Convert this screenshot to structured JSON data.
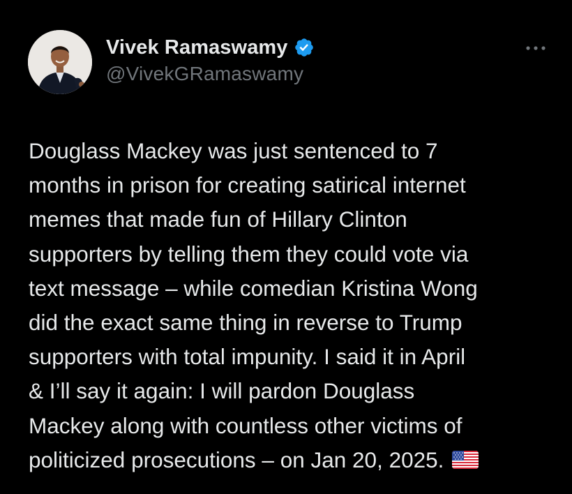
{
  "author": {
    "display_name": "Vivek Ramaswamy",
    "handle": "@VivekGRamaswamy",
    "verified": true,
    "verified_icon": "verified-badge-icon",
    "avatar_icon": "profile-photo"
  },
  "more_button": {
    "label": "•••",
    "icon": "more-options-icon"
  },
  "tweet": {
    "lines": [
      "Douglass Mackey was just sentenced to 7",
      "months in prison for creating satirical internet",
      "memes that made fun of Hillary Clinton",
      "supporters by telling them they could vote via",
      "text message – while comedian Kristina Wong",
      "did the exact same thing in reverse to Trump",
      "supporters with total impunity. I said it in April",
      "& I’ll say it again: I will pardon Douglass",
      "Mackey along with countless other victims of",
      "politicized prosecutions – on Jan 20, 2025."
    ],
    "trailing_emoji": "us-flag-icon"
  },
  "colors": {
    "background": "#000000",
    "text_primary": "#e7e9ea",
    "text_secondary": "#71767b",
    "verified_blue": "#1d9bf0"
  }
}
